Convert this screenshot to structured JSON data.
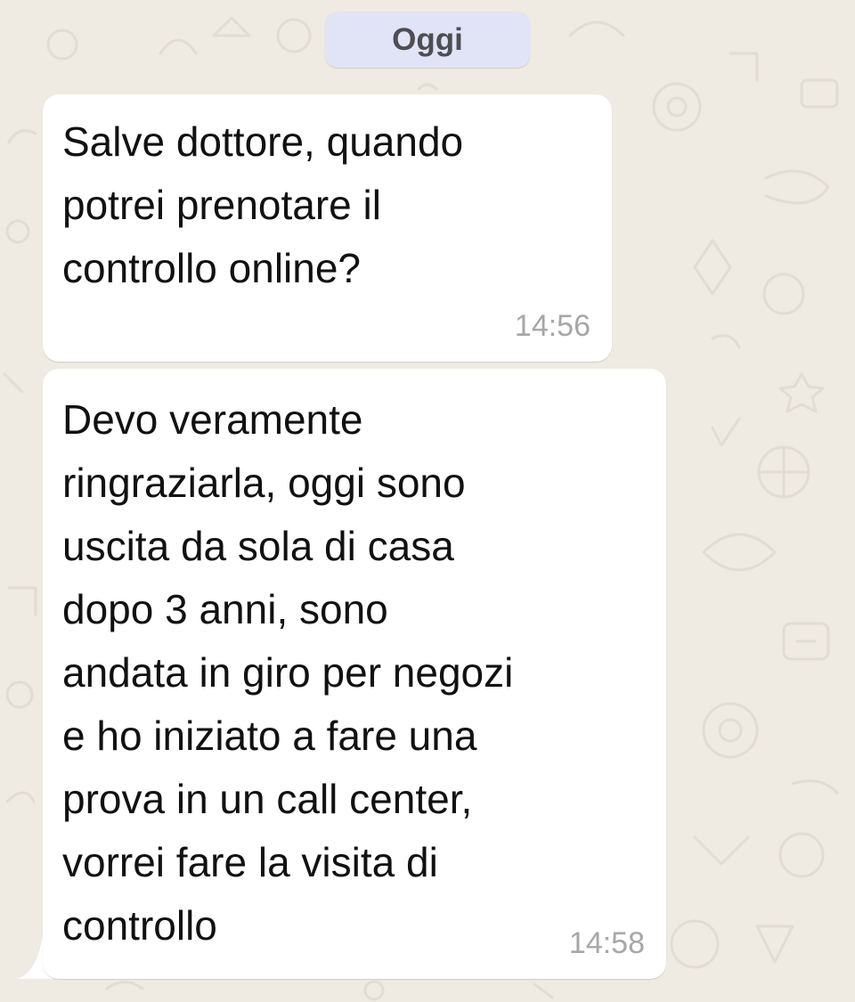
{
  "chat": {
    "date_separator": "Oggi",
    "messages": [
      {
        "text": "Salve dottore, quando\npotrei prenotare il\ncontrollo online?",
        "time": "14:56"
      },
      {
        "text": "Devo veramente\nringraziarla, oggi sono\nuscita da sola di casa\ndopo 3 anni, sono\nandata in giro per negozi\ne ho iniziato a fare una\nprova in un call center,\nvorrei fare la visita di\ncontrollo",
        "time": "14:58"
      }
    ]
  },
  "colors": {
    "wallpaper": "#efeae2",
    "bubble": "#ffffff",
    "date_chip": "#e1e3f7",
    "timestamp": "#a7a7a7"
  }
}
